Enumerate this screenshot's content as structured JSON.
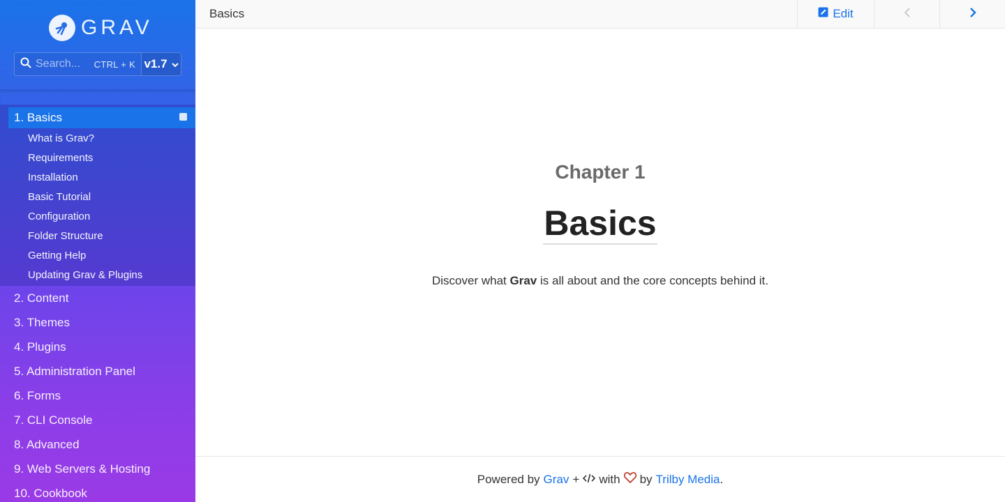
{
  "sidebar": {
    "logo_text": "GRAV",
    "search": {
      "placeholder": "Search...",
      "shortcut": "CTRL + K"
    },
    "version": "v1.7",
    "active_section": {
      "label": "1. Basics",
      "items": [
        {
          "label": "What is Grav?"
        },
        {
          "label": "Requirements"
        },
        {
          "label": "Installation"
        },
        {
          "label": "Basic Tutorial"
        },
        {
          "label": "Configuration"
        },
        {
          "label": "Folder Structure"
        },
        {
          "label": "Getting Help"
        },
        {
          "label": "Updating Grav & Plugins"
        }
      ]
    },
    "sections": [
      {
        "label": "2. Content"
      },
      {
        "label": "3. Themes"
      },
      {
        "label": "4. Plugins"
      },
      {
        "label": "5. Administration Panel"
      },
      {
        "label": "6. Forms"
      },
      {
        "label": "7. CLI Console"
      },
      {
        "label": "8. Advanced"
      },
      {
        "label": "9. Web Servers & Hosting"
      },
      {
        "label": "10. Cookbook"
      }
    ]
  },
  "header": {
    "title": "Basics",
    "edit_label": "Edit",
    "colors": {
      "accent": "#1a73e8",
      "disabled": "#cccccc"
    }
  },
  "main": {
    "chapter": "Chapter 1",
    "title": "Basics",
    "description_pre": "Discover what",
    "description_strong": "Grav",
    "description_post": "is all about and the core concepts behind it."
  },
  "footer": {
    "powered_by": "Powered by",
    "grav_link": "Grav",
    "plus": "+",
    "with": "with",
    "by": "by",
    "trilby_link": "Trilby Media",
    "period": "."
  }
}
